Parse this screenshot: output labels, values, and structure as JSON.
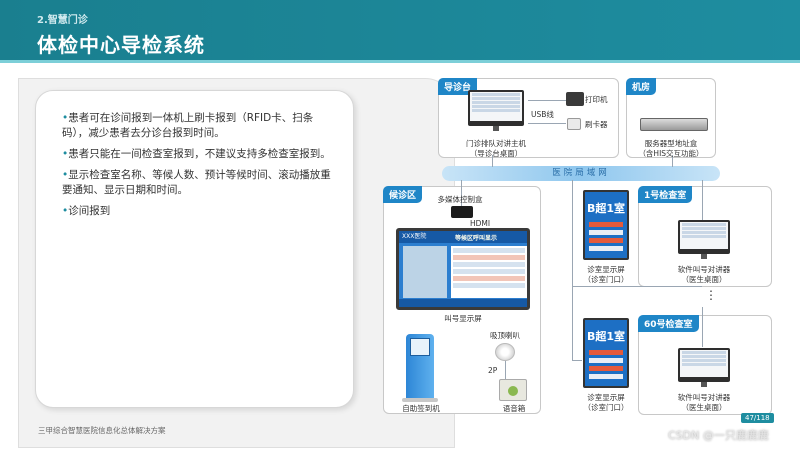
{
  "header": {
    "section": "2.智慧门诊",
    "title": "体检中心导检系统"
  },
  "left": {
    "bullets": [
      "患者可在诊间报到一体机上刷卡报到（RFID卡、扫条码），减少患者去分诊台报到时间。",
      "患者只能在一间检查室报到，不建议支持多检查室报到。",
      "显示检查室名称、等候人数、预计等候时间、滚动播放重要通知、显示日期和时间。",
      "诊间报到"
    ],
    "bullet_mark": "•"
  },
  "footer": {
    "text": "三甲综合智慧医院信息化总体解决方案",
    "page": "47/118",
    "watermark": "CSDN @一只鹿鹿鹿"
  },
  "diagram": {
    "triage": {
      "tag": "导诊台",
      "host_label_1": "门诊排队对讲主机",
      "host_label_2": "（导诊台桌面）",
      "usb": "USB线",
      "printer": "打印机",
      "card_reader": "刷卡器"
    },
    "server_room": {
      "tag": "机房",
      "label_1": "服务器型地址盒",
      "label_2": "（含HIS交互功能）"
    },
    "lan": "医院局域网",
    "waiting": {
      "tag": "候诊区",
      "media_box": "多媒体控制盒",
      "hdmi": "HDMI",
      "screen_title": "XXX医院",
      "screen_header": "等候区呼叫显示",
      "call_screen_label": "叫号显示屏",
      "ceiling_speaker": "吸顶喇叭",
      "cable": "2P",
      "kiosk": "自助签到机",
      "speaker_box": "语音箱"
    },
    "room_screen_1": {
      "room": "B超1室",
      "label_1": "诊室显示屏",
      "label_2": "（诊室门口）"
    },
    "room_screen_2": {
      "room": "B超1室",
      "label_1": "诊室显示屏",
      "label_2": "（诊室门口）"
    },
    "room_1": {
      "tag": "1号检查室",
      "label_1": "软件叫号对讲器",
      "label_2": "（医生桌面）"
    },
    "room_60": {
      "tag": "60号检查室",
      "label_1": "软件叫号对讲器",
      "label_2": "（医生桌面）"
    },
    "ellipsis": "⋮"
  },
  "colors": {
    "header": "#1a7f8f",
    "tag": "#1f86c7",
    "screen": "#1d6fc4"
  }
}
